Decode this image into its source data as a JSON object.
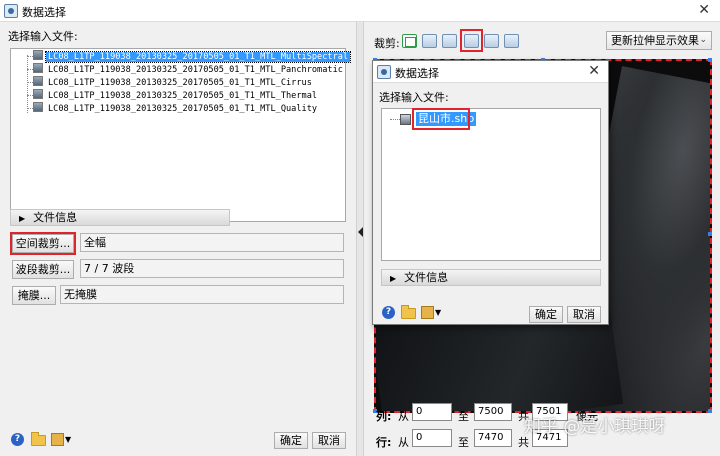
{
  "window": {
    "title": "数据选择",
    "close_glyph": "✕"
  },
  "left": {
    "input_label": "选择输入文件:",
    "files": [
      "LC08_L1TP_119038_20130325_20170505_01_T1_MTL_MultiSpectral",
      "LC08_L1TP_119038_20130325_20170505_01_T1_MTL_Panchromatic",
      "LC08_L1TP_119038_20130325_20170505_01_T1_MTL_Cirrus",
      "LC08_L1TP_119038_20130325_20170505_01_T1_MTL_Thermal",
      "LC08_L1TP_119038_20130325_20170505_01_T1_MTL_Quality"
    ],
    "file_info": "文件信息",
    "spatial_subset_button": "空间裁剪...",
    "spatial_subset_value": "全幅",
    "spectral_subset_button": "波段裁剪...",
    "spectral_subset_value": "7 / 7 波段",
    "mask_button": "掩膜...",
    "mask_value": "无掩膜",
    "ok": "确定",
    "cancel": "取消"
  },
  "right": {
    "crop_label": "裁剪:",
    "stretch_dropdown": "更新拉伸显示效果",
    "row_label": "列:",
    "col_label": "行:",
    "from": "从",
    "to": "至",
    "total": "共",
    "pixels": "像元",
    "row_from": "0",
    "row_to": "7500",
    "row_total": "7501",
    "col_from": "0",
    "col_to": "7470",
    "col_total": "7471"
  },
  "sub_dialog": {
    "title": "数据选择",
    "input_label": "选择输入文件:",
    "file": "昆山市.shp",
    "file_info": "文件信息",
    "ok": "确定",
    "cancel": "取消"
  },
  "watermark": "知乎 @是小琪琪呀",
  "colors": {
    "highlight": "#e0242b",
    "selection": "#3399ff"
  },
  "icons": [
    "app-icon",
    "close-icon",
    "help-icon",
    "folder-icon",
    "toolbox-icon",
    "crop-rect-icon",
    "crop-icon",
    "chevron-down-icon",
    "triangle-right-icon",
    "shapefile-icon"
  ]
}
